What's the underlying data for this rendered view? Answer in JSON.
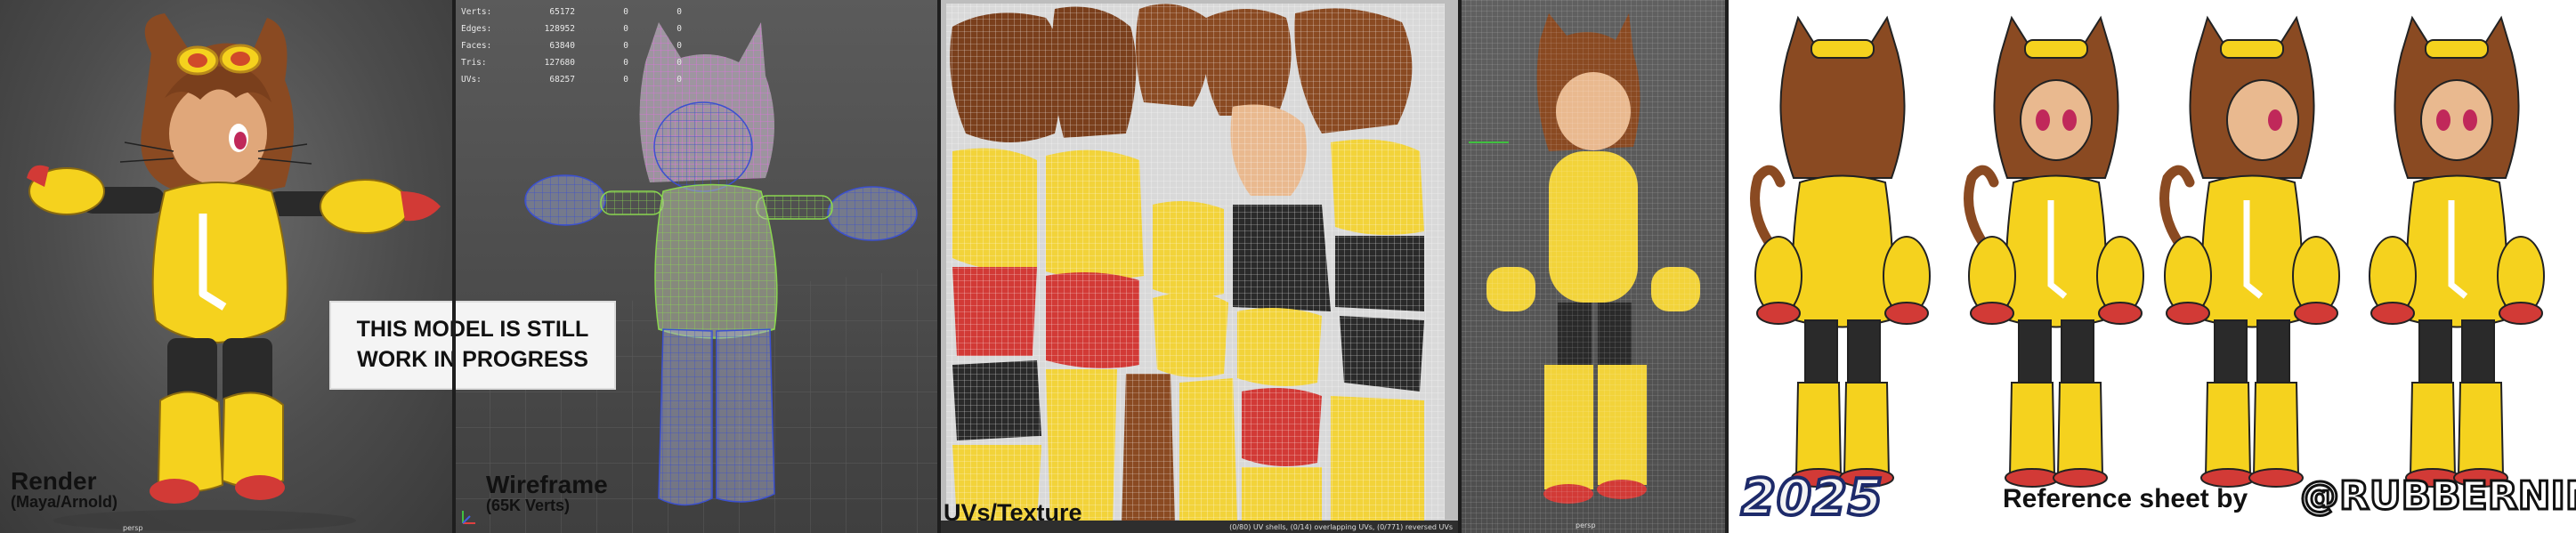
{
  "panels": {
    "render": {
      "title": "Render",
      "subtitle": "(Maya/Arnold)",
      "cam_label": "persp"
    },
    "wireframe": {
      "title": "Wireframe",
      "subtitle": "(65K Verts)"
    },
    "uv": {
      "title": "UVs/Texture",
      "status": "(0/80) UV shells, (0/14) overlapping UVs, (0/771) reversed UVs"
    },
    "persp": {
      "cam_label": "persp"
    },
    "reference": {
      "year": "2025",
      "credit": "Reference sheet by",
      "handle": "@RUBBERNINJA"
    }
  },
  "notice": {
    "line1": "THIS MODEL IS STILL",
    "line2": "WORK IN PROGRESS"
  },
  "stats": [
    {
      "label": "Verts:",
      "v1": "65172",
      "v2": "0",
      "v3": "0"
    },
    {
      "label": "Edges:",
      "v1": "128952",
      "v2": "0",
      "v3": "0"
    },
    {
      "label": "Faces:",
      "v1": "63840",
      "v2": "0",
      "v3": "0"
    },
    {
      "label": "Tris:",
      "v1": "127680",
      "v2": "0",
      "v3": "0"
    },
    {
      "label": "UVs:",
      "v1": "68257",
      "v2": "0",
      "v3": "0"
    }
  ],
  "colors": {
    "suit_yellow": "#f5d21e",
    "hair_brown": "#8a4a22",
    "skin": "#e9b98f",
    "glove_red": "#d23a36",
    "legging_dark": "#2a2a2a",
    "wire_blue": "#3b50d0",
    "wire_pink": "#e070e0",
    "wire_green": "#8ad650"
  }
}
